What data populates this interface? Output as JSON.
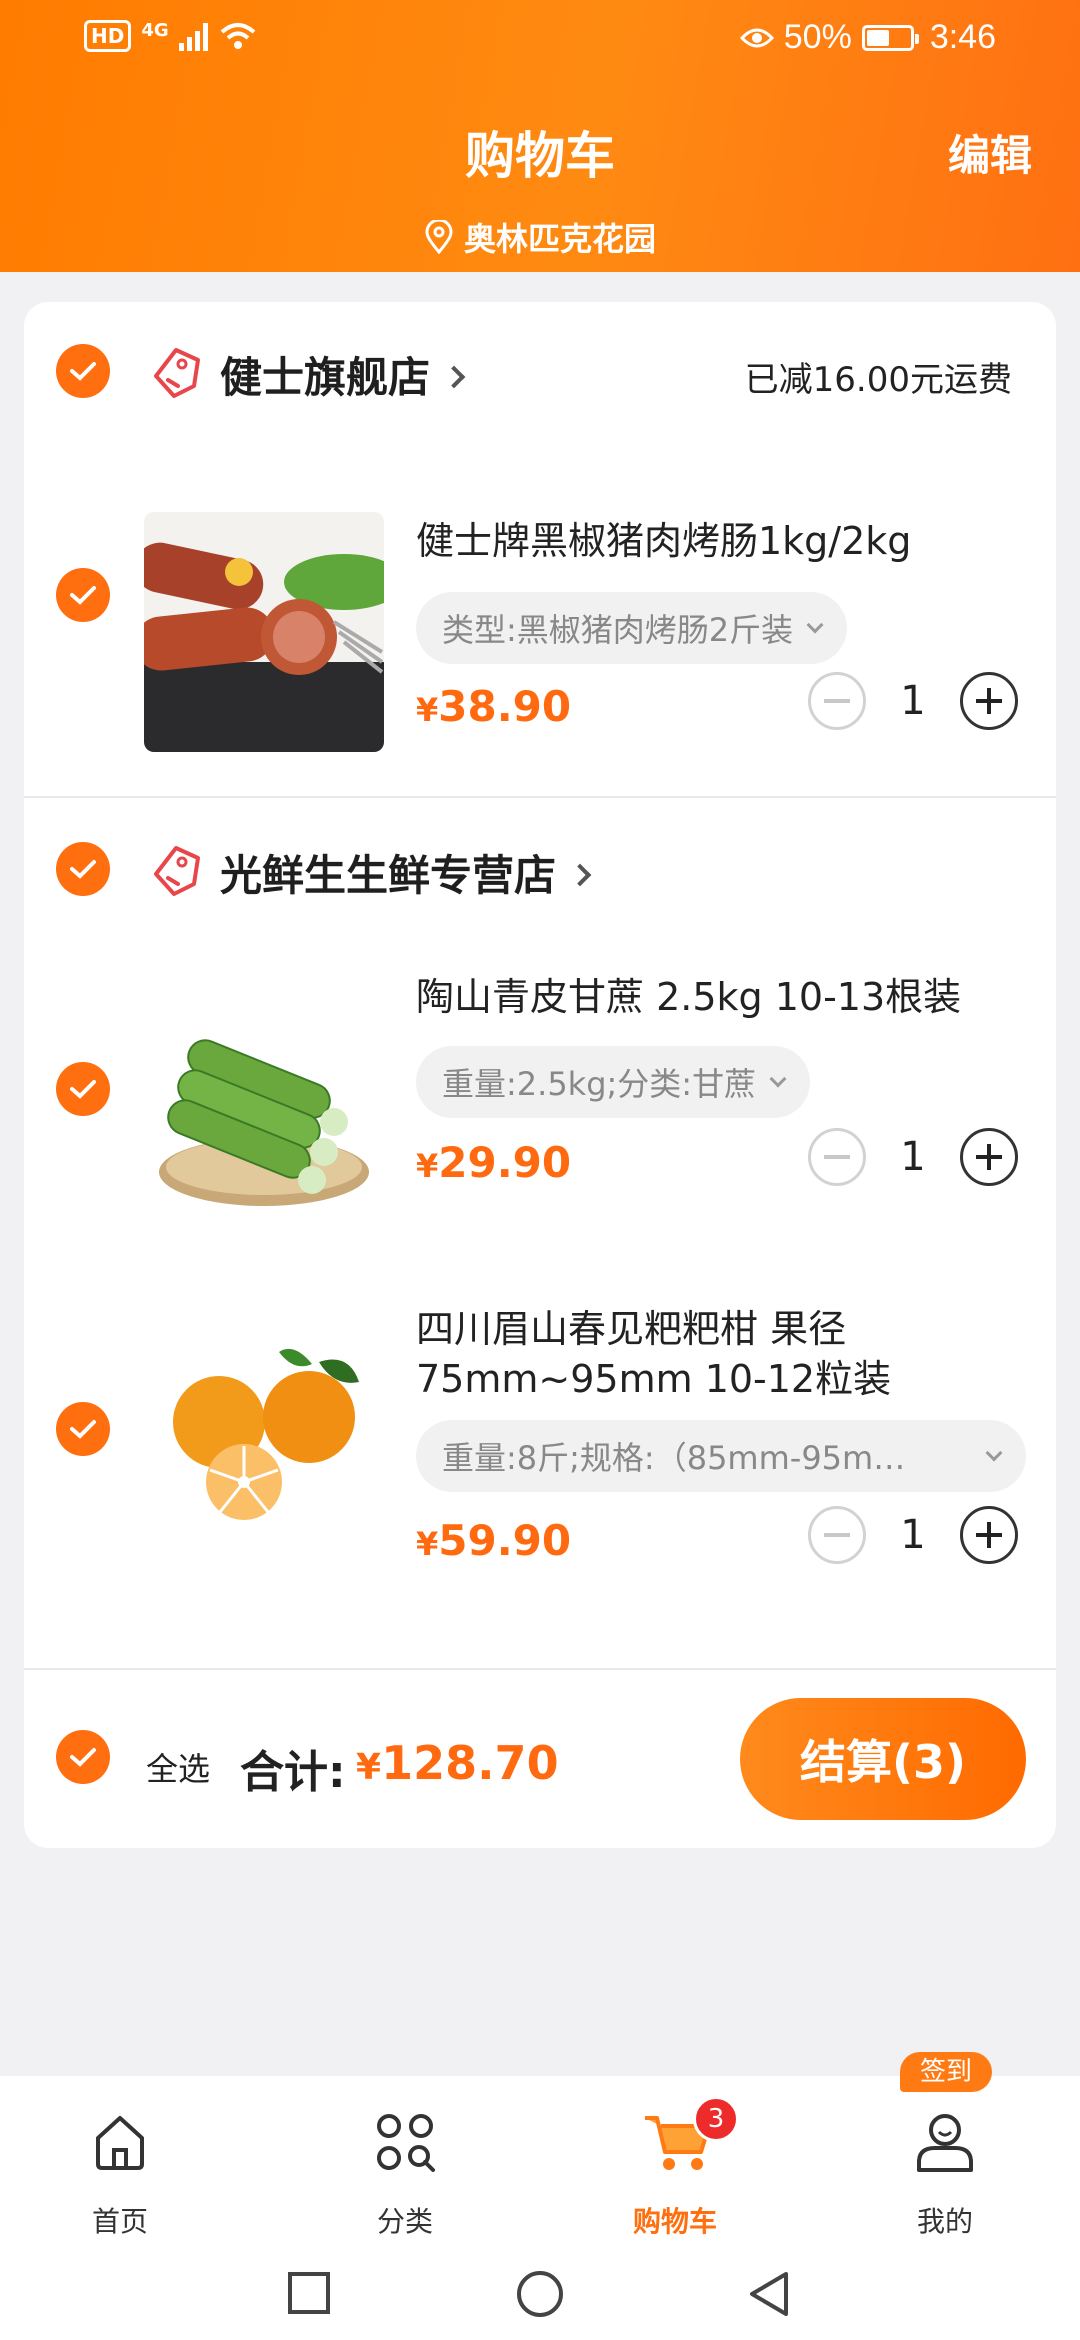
{
  "status_bar": {
    "network": "4G",
    "hd": "HD",
    "battery": "50%",
    "time": "3:46"
  },
  "header": {
    "title": "购物车",
    "edit_label": "编辑",
    "location": "奥林匹克花园"
  },
  "stores": [
    {
      "name": "健士旗舰店",
      "note": "已减16.00元运费",
      "items": [
        {
          "title": "健士牌黑椒猪肉烤肠1kg/2kg",
          "spec": "类型:黑椒猪肉烤肠2斤装",
          "price_symbol": "¥",
          "price": "38.90",
          "qty": "1"
        }
      ]
    },
    {
      "name": "光鲜生生鲜专营店",
      "note": "",
      "items": [
        {
          "title": "陶山青皮甘蔗 2.5kg 10-13根装",
          "spec": "重量:2.5kg;分类:甘蔗",
          "price_symbol": "¥",
          "price": "29.90",
          "qty": "1"
        },
        {
          "title": "四川眉山春见粑粑柑 果径 75mm~95mm 10-12粒装",
          "spec": "重量:8斤;规格:（85mm-95m…",
          "price_symbol": "¥",
          "price": "59.90",
          "qty": "1"
        }
      ]
    }
  ],
  "summary": {
    "select_all_label": "全选",
    "total_label": "合计:",
    "total_symbol": "¥",
    "total_value": "128.70",
    "checkout_label": "结算(3)"
  },
  "tabbar": {
    "items": [
      {
        "label": "首页",
        "icon": "home-icon"
      },
      {
        "label": "分类",
        "icon": "category-icon"
      },
      {
        "label": "购物车",
        "icon": "cart-icon",
        "badge": "3"
      },
      {
        "label": "我的",
        "icon": "profile-icon"
      }
    ],
    "sign_badge": "签到"
  },
  "colors": {
    "accent": "#ff6f0f",
    "header_gradient_start": "#ff7c00",
    "price": "#ff6a10",
    "badge_red": "#ee2b2b"
  }
}
